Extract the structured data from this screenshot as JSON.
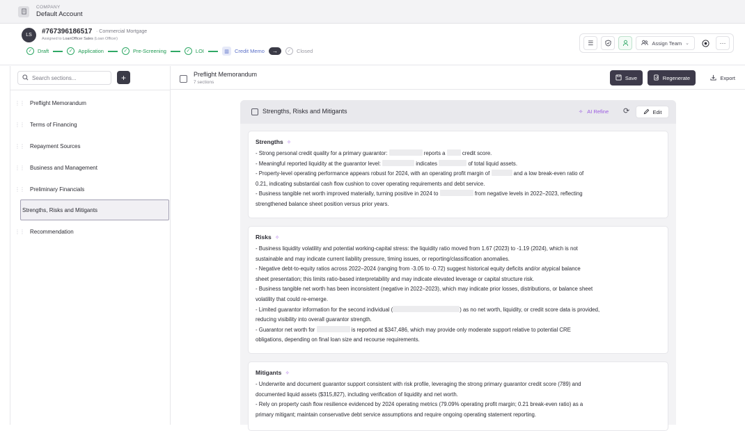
{
  "company": {
    "label": "COMPANY",
    "name": "Default Account"
  },
  "loan": {
    "avatar": "LS",
    "id": "#767396186517",
    "type": "· Commercial Mortgage",
    "assigned_prefix": "Assigned to",
    "assigned_name": "LoanOfficer Sales",
    "assigned_role": "(Loan Officer)"
  },
  "steps": [
    "Draft",
    "Application",
    "Pre-Screening",
    "LOI",
    "Credit Memo",
    "Closed"
  ],
  "actions": {
    "assign_team": "Assign Team"
  },
  "sidebar": {
    "search_placeholder": "Search sections...",
    "sections": [
      "Preflight Memorandum",
      "Terms of Financing",
      "Repayment Sources",
      "Business and Management",
      "Preliminary Financials",
      "Strengths, Risks and Mitigants",
      "Recommendation"
    ]
  },
  "header": {
    "title": "Preflight Memorandum",
    "subtitle": "7 sections",
    "save": "Save",
    "regenerate": "Regenerate",
    "export": "Export"
  },
  "panel": {
    "title": "Strengths, Risks and Mitigants",
    "ai_refine": "AI Refine",
    "edit": "Edit"
  },
  "cards": {
    "strengths": {
      "title": "Strengths",
      "l1a": "- Strong personal credit quality for a primary guarantor:",
      "l1b": "reports a",
      "l1c": "credit score.",
      "l2a": "- Meaningful reported liquidity at the guarantor level:",
      "l2b": "indicates",
      "l2c": "of total liquid assets.",
      "l3a": "- Property-level operating performance appears robust for 2024, with an operating profit margin of",
      "l3b": "and a low break-even ratio of",
      "l3c": "0.21, indicating substantial cash flow cushion to cover operating requirements and debt service.",
      "l4a": "- Business tangible net worth improved materially, turning positive in 2024 to",
      "l4b": "from negative levels in 2022–2023, reflecting",
      "l4c": "strengthened balance sheet position versus prior years."
    },
    "risks": {
      "title": "Risks",
      "l1": "- Business liquidity volatility and potential working-capital stress: the liquidity ratio moved from 1.67 (2023) to -1.19 (2024), which is not",
      "l2": "sustainable and may indicate current liability pressure, timing issues, or reporting/classification anomalies.",
      "l3": "- Negative debt-to-equity ratios across 2022–2024 (ranging from -3.05 to -0.72) suggest historical equity deficits and/or atypical balance",
      "l4": "sheet presentation; this limits ratio-based interpretability and may indicate elevated leverage or capital structure risk.",
      "l5": "- Business tangible net worth has been inconsistent (negative in 2022–2023), which may indicate prior losses, distributions, or balance sheet",
      "l6": "volatility that could re-emerge.",
      "l7a": "- Limited guarantor information for the second individual (",
      "l7b": ") as no net worth, liquidity, or credit score data is provided,",
      "l8": "reducing visibility into overall guarantor strength.",
      "l9a": "- Guarantor net worth for",
      "l9b": "is reported at $347,486, which may provide only moderate support relative to potential CRE",
      "l10": "obligations, depending on final loan size and recourse requirements."
    },
    "mitigants": {
      "title": "Mitigants",
      "l1": "- Underwrite and document guarantor support consistent with risk profile, leveraging the strong primary guarantor credit score (789) and",
      "l2": "documented liquid assets ($315,827), including verification of liquidity and net worth.",
      "l3": "- Rely on property cash flow resilience evidenced by 2024 operating metrics (79.09% operating profit margin; 0.21 break-even ratio) as a",
      "l4": "primary mitigant; maintain conservative debt service assumptions and require ongoing operating statement reporting."
    }
  }
}
